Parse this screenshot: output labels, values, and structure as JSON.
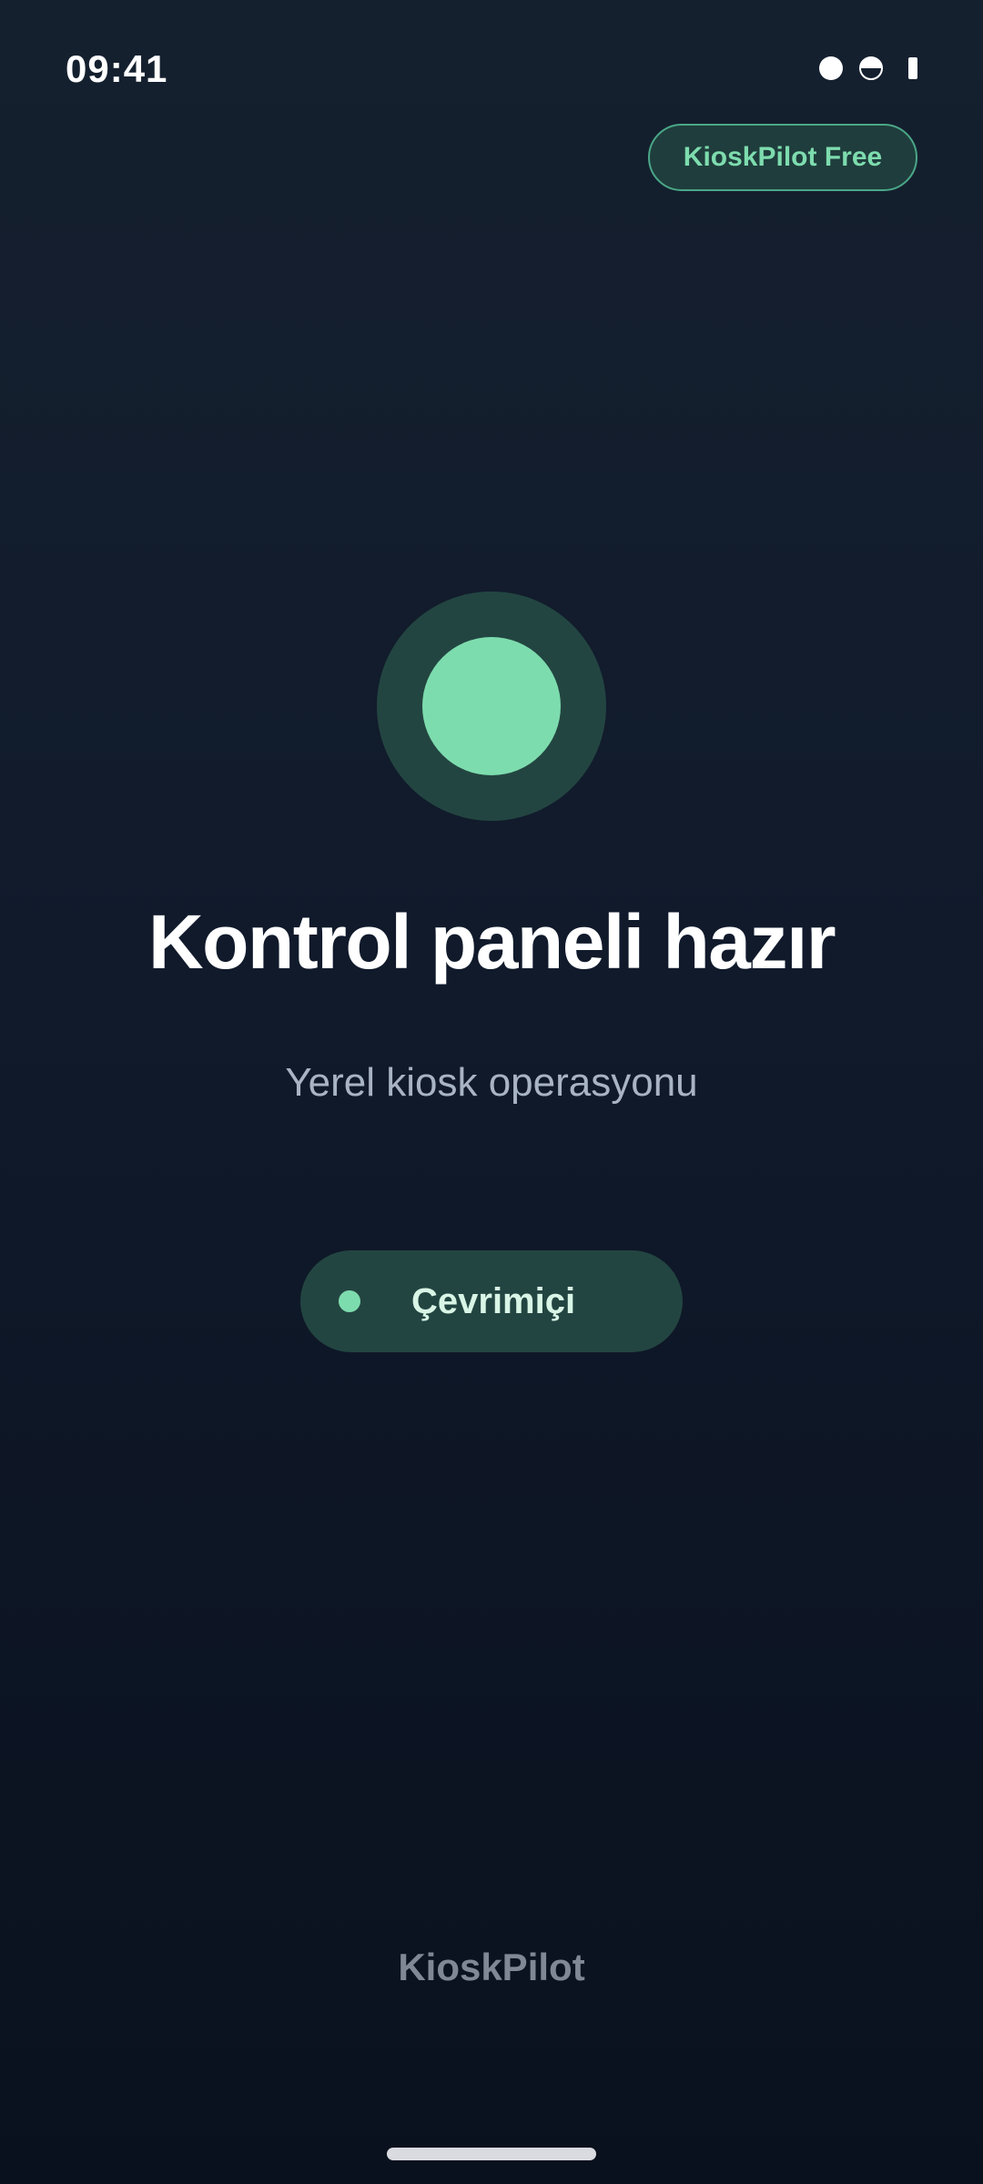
{
  "status_bar": {
    "time": "09:41",
    "icons": [
      "signal-dot-icon",
      "half-circle-icon",
      "battery-icon"
    ]
  },
  "header": {
    "plan_badge": "KioskPilot Free"
  },
  "hero": {
    "icon": "status-circle-icon",
    "title": "Kontrol paneli hazır",
    "subtitle": "Yerel kiosk operasyonu"
  },
  "connection": {
    "label": "Çevrimiçi",
    "indicator_color": "#7ddcae"
  },
  "footer": {
    "brand": "KioskPilot"
  },
  "colors": {
    "accent": "#7ddcae",
    "accent_dark": "#234541",
    "background_top": "#15202f",
    "background_bottom": "#0a111e"
  }
}
